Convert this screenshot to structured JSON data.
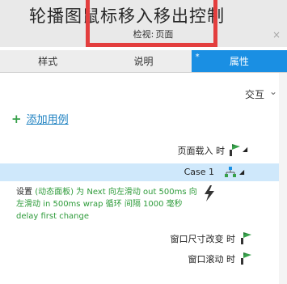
{
  "overlay": {
    "caption": "轮播图鼠标移入移出控制"
  },
  "selection": {
    "label": "检视:",
    "value": "页面",
    "close_glyph": "×"
  },
  "tabs": [
    {
      "label": "样式",
      "active": false
    },
    {
      "label": "说明",
      "active": false
    },
    {
      "label": "属性",
      "active": true,
      "marker": "*"
    }
  ],
  "interactions": {
    "section_label": "交互",
    "add_case_label": "添加用例",
    "events": [
      {
        "label": "页面载入 时"
      },
      {
        "label": "Case 1"
      },
      {
        "label": "窗口尺寸改变 时"
      },
      {
        "label": "窗口滚动 时"
      }
    ],
    "action": {
      "prefix": "设置 ",
      "green_text": "(动态面板) 为 Next 向左滑动 out 500ms 向左滑动 in 500ms wrap 循环 间隔 1000 毫秒 delay first change"
    }
  },
  "colors": {
    "accent": "#1a8fe3",
    "highlight_red": "#e33e3e",
    "link": "#1a7fc0",
    "action_green": "#2e9b3a",
    "selected_row": "#cfe8fb"
  },
  "icons": [
    "flag-icon",
    "case-tree-icon",
    "lightning-icon",
    "plus-icon",
    "chevron-down-icon"
  ]
}
